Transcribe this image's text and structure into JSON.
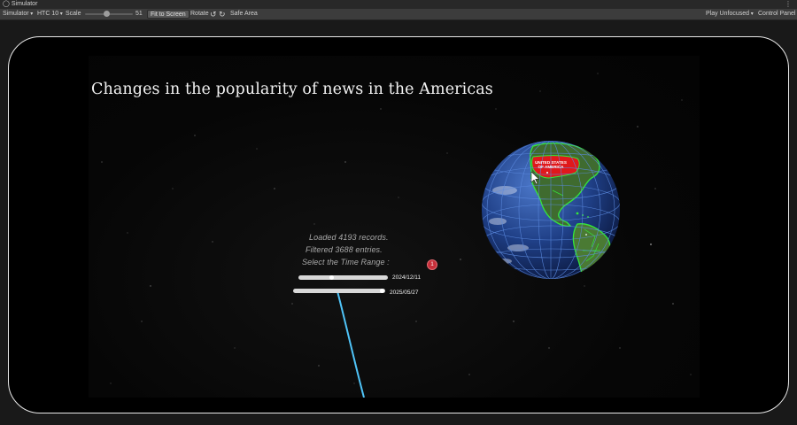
{
  "window": {
    "title": "Simulator"
  },
  "toolbar": {
    "mode_label": "Simulator",
    "device_label": "HTC 10",
    "scale_label": "Scale",
    "scale_value": "51",
    "fit_label": "Fit to Screen",
    "rotate_label": "Rotate",
    "safe_area_label": "Safe Area",
    "play_mode_label": "Play Unfocused",
    "control_panel_label": "Control Panel"
  },
  "scene": {
    "title": "Changes in the popularity of news in the Americas",
    "loaded_text": "Loaded 4193 records.",
    "filtered_text": "Filtered 3688 entries.",
    "range_prompt": "Select the Time Range :",
    "range_start": "2024/12/11",
    "range_end": "2025/05/27",
    "range_start_fill": 0.32,
    "globe_label_line1": "UNITED STATES",
    "globe_label_line2": "OF AMERICA",
    "pin_label": "1"
  },
  "colors": {
    "accent_beam": "#4fc3f7",
    "highlight_country": "#e0181b",
    "borders": "#35e83a",
    "pin": "#c72f3a"
  }
}
